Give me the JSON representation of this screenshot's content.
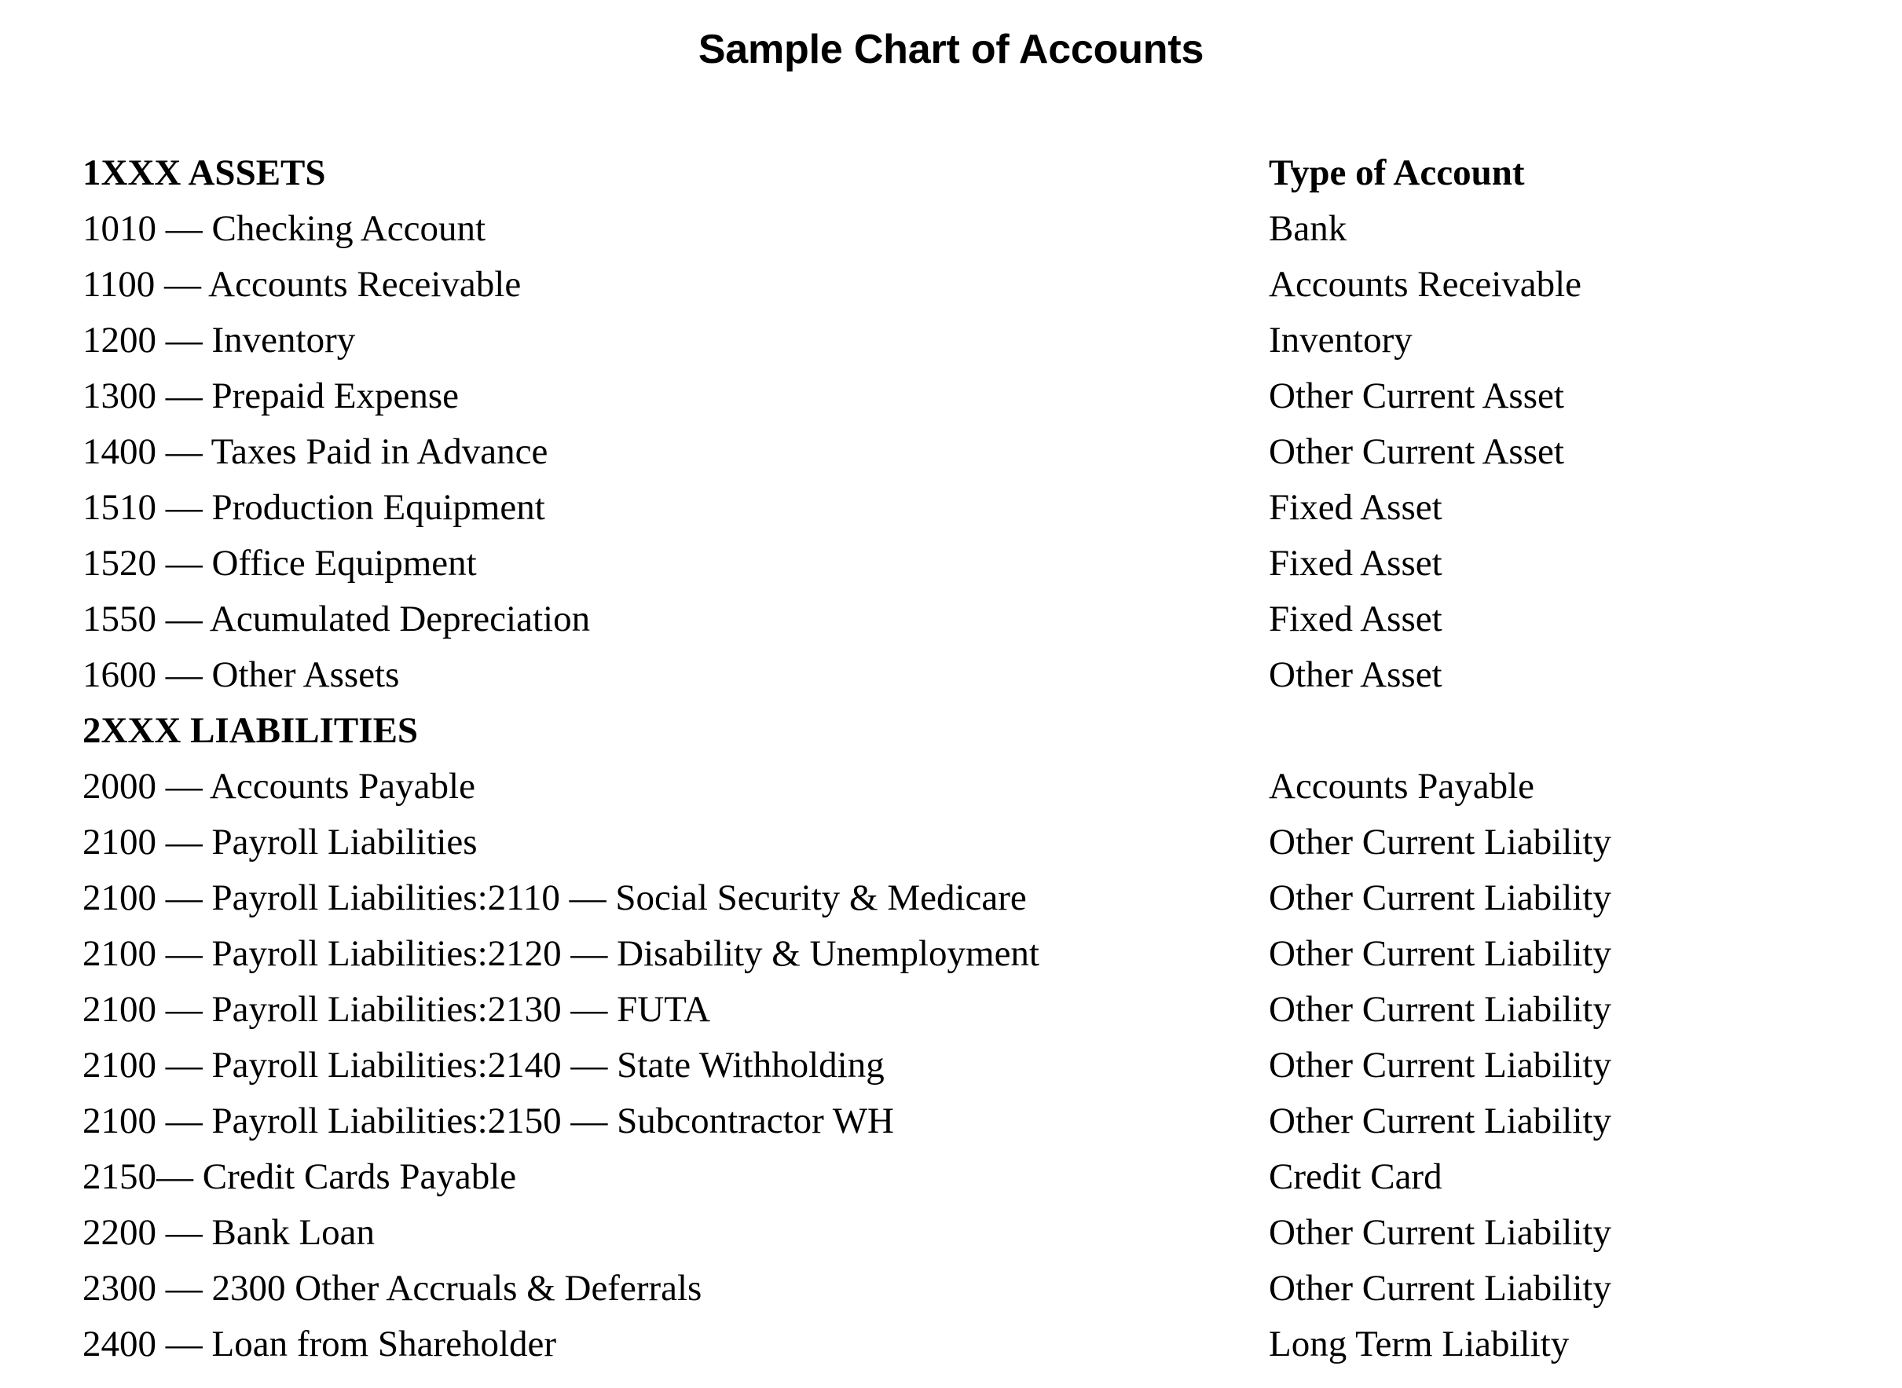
{
  "document": {
    "title": "Sample Chart of Accounts"
  },
  "table": {
    "rows": [
      {
        "account": "1XXX ASSETS",
        "type": "Type of Account",
        "is_section": true
      },
      {
        "account": "1010 — Checking Account",
        "type": "Bank",
        "is_section": false
      },
      {
        "account": "1100 — Accounts Receivable",
        "type": "Accounts Receivable",
        "is_section": false
      },
      {
        "account": "1200 — Inventory",
        "type": "Inventory",
        "is_section": false
      },
      {
        "account": "1300 — Prepaid Expense",
        "type": "Other Current Asset",
        "is_section": false
      },
      {
        "account": "1400 — Taxes Paid in Advance",
        "type": "Other Current Asset",
        "is_section": false
      },
      {
        "account": "1510 — Production Equipment",
        "type": "Fixed Asset",
        "is_section": false
      },
      {
        "account": "1520 — Office Equipment",
        "type": "Fixed Asset",
        "is_section": false
      },
      {
        "account": "1550 — Acumulated Depreciation",
        "type": "Fixed Asset",
        "is_section": false
      },
      {
        "account": "1600 — Other Assets",
        "type": "Other Asset",
        "is_section": false
      },
      {
        "account": "2XXX LIABILITIES",
        "type": "",
        "is_section": true
      },
      {
        "account": "2000 — Accounts Payable",
        "type": "Accounts Payable",
        "is_section": false
      },
      {
        "account": "2100 — Payroll Liabilities",
        "type": "Other Current Liability",
        "is_section": false
      },
      {
        "account": "2100 — Payroll Liabilities:2110 — Social Security & Medicare",
        "type": "Other Current Liability",
        "is_section": false
      },
      {
        "account": "2100 — Payroll Liabilities:2120 — Disability & Unemployment",
        "type": "Other Current Liability",
        "is_section": false
      },
      {
        "account": "2100 — Payroll Liabilities:2130 — FUTA",
        "type": "Other Current Liability",
        "is_section": false
      },
      {
        "account": "2100 — Payroll Liabilities:2140 — State Withholding",
        "type": "Other Current Liability",
        "is_section": false
      },
      {
        "account": "2100 — Payroll Liabilities:2150 — Subcontractor WH",
        "type": "Other Current Liability",
        "is_section": false
      },
      {
        "account": "2150— Credit Cards Payable",
        "type": "Credit Card",
        "is_section": false
      },
      {
        "account": "2200 — Bank Loan",
        "type": "Other Current Liability",
        "is_section": false
      },
      {
        "account": "2300 — 2300 Other Accruals & Deferrals",
        "type": "Other Current Liability",
        "is_section": false
      },
      {
        "account": "2400 — Loan from Shareholder",
        "type": "Long Term Liability",
        "is_section": false
      }
    ]
  }
}
